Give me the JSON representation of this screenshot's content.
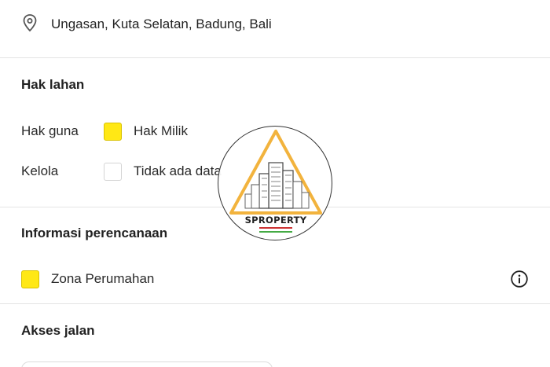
{
  "location": {
    "icon": "location-pin-icon",
    "text": "Ungasan, Kuta Selatan, Badung, Bali"
  },
  "land_rights": {
    "title": "Hak lahan",
    "rows": [
      {
        "label": "Hak guna",
        "value": "Hak Milik",
        "swatch": "yellow"
      },
      {
        "label": "Kelola",
        "value": "Tidak ada data",
        "swatch": "empty"
      }
    ]
  },
  "planning": {
    "title": "Informasi perencanaan",
    "zone": {
      "value": "Zona Perumahan",
      "swatch": "yellow"
    },
    "info_icon": "info-icon"
  },
  "road_access": {
    "title": "Akses jalan"
  },
  "watermark": {
    "brand": "SPROPERTY"
  },
  "colors": {
    "accent_yellow": "#ffe815",
    "divider": "#e4e4e4",
    "text": "#222222"
  }
}
